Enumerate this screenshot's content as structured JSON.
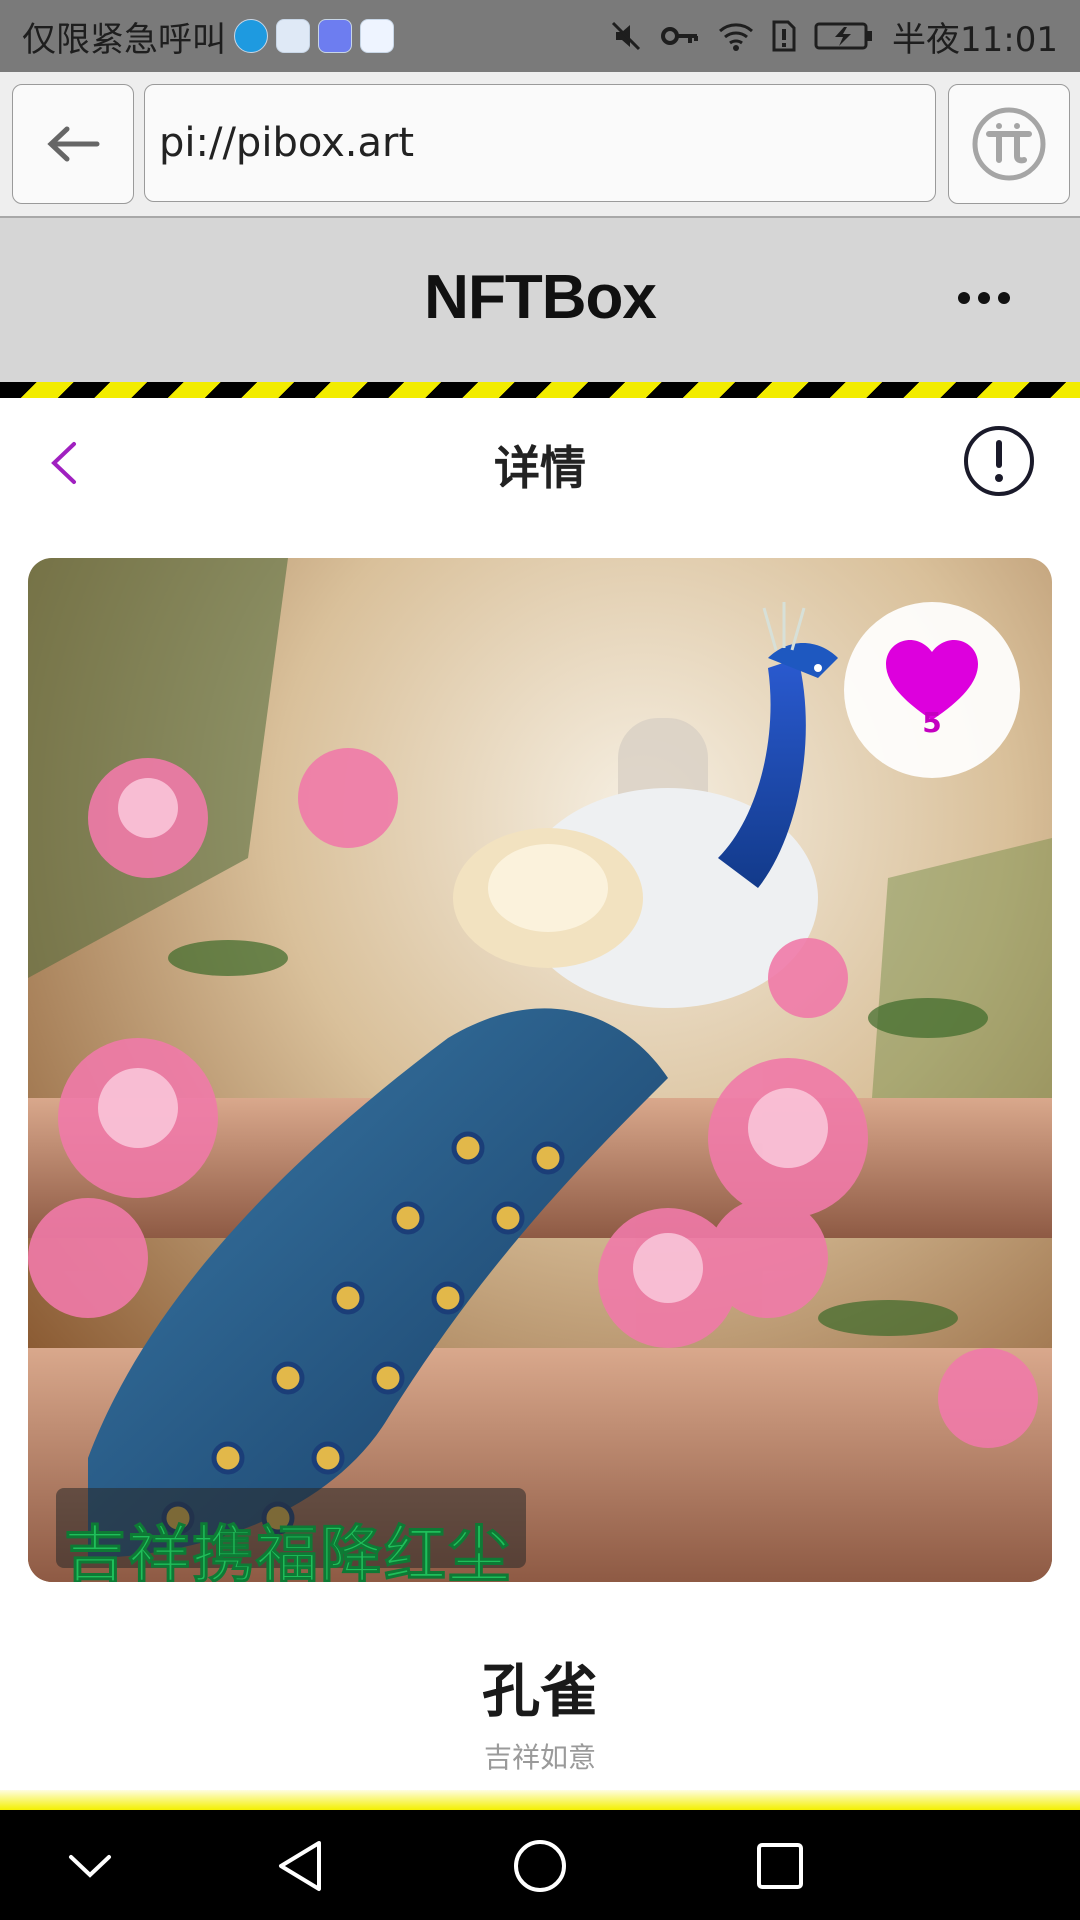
{
  "status_bar": {
    "carrier": "仅限紧急呼叫",
    "time": "半夜11:01"
  },
  "browser": {
    "url": "pi://pibox.art"
  },
  "app": {
    "title": "NFTBox"
  },
  "page": {
    "title": "详情"
  },
  "nft": {
    "likes": "5",
    "caption": "吉祥携福降红尘",
    "name": "孔雀",
    "subtitle": "吉祥如意"
  },
  "colors": {
    "accent_purple": "#a020c0",
    "like_magenta": "#dd00dd",
    "caption_green": "#1fbf5a",
    "hazard_yellow": "#f2ec00"
  }
}
